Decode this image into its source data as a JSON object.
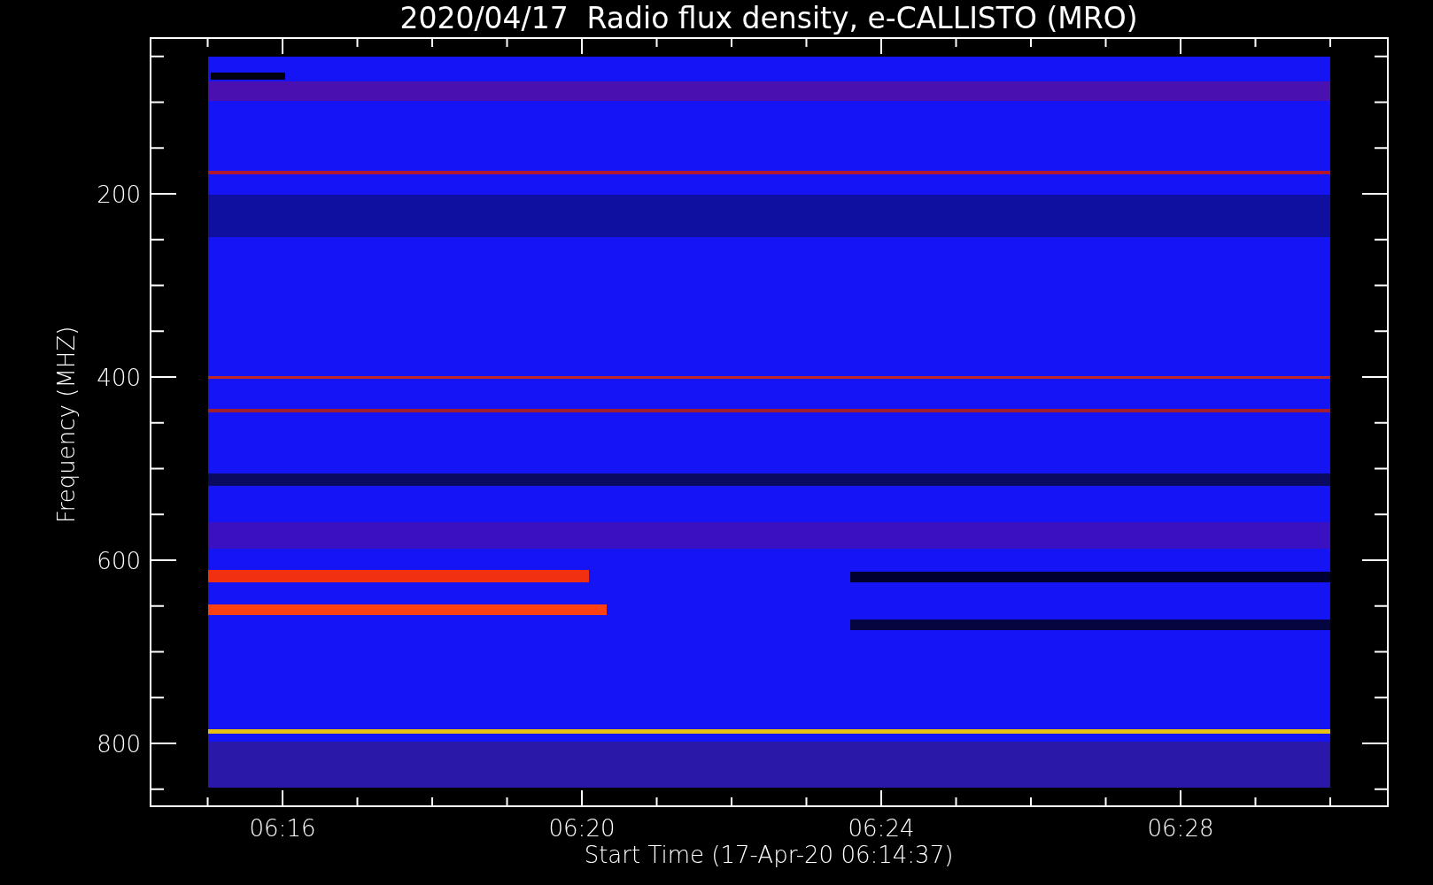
{
  "title": "2020/04/17  Radio flux density, e-CALLISTO (MRO)",
  "y_axis": {
    "label": "Frequency (MHZ)",
    "ticks": [
      "200",
      "400",
      "600",
      "800"
    ]
  },
  "x_axis": {
    "label": "Start Time (17-Apr-20 06:14:37)",
    "ticks": [
      "06:16",
      "06:20",
      "06:24",
      "06:28"
    ]
  }
}
